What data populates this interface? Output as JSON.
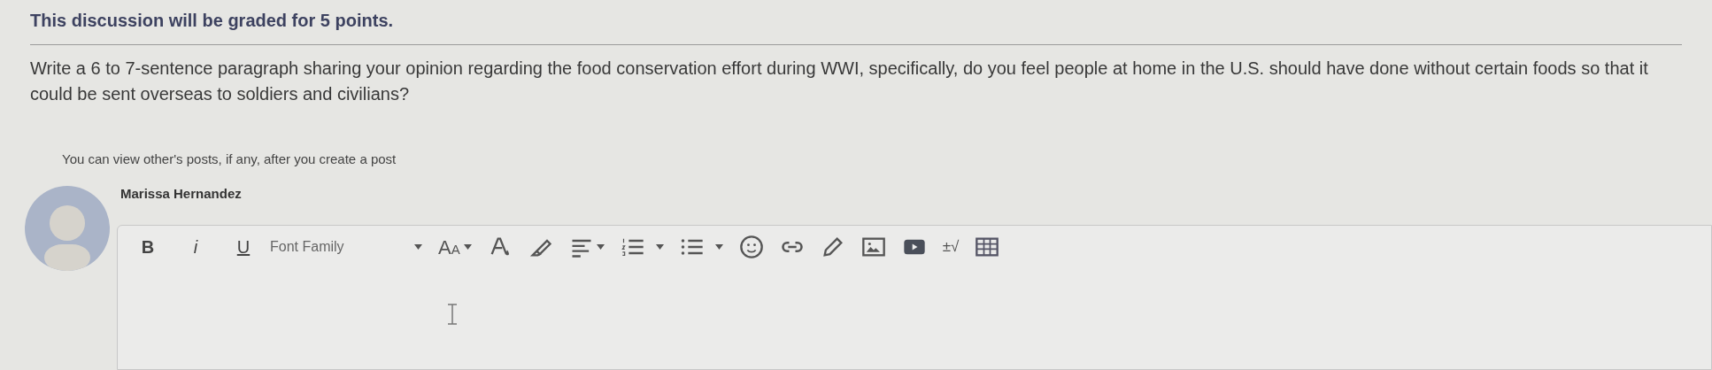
{
  "heading": "This discussion will be graded for 5 points.",
  "prompt": "Write a 6 to 7-sentence paragraph sharing your opinion regarding the food conservation effort during WWI, specifically, do you feel people at home in the U.S. should have done without certain foods so that it could be sent overseas to soldiers and civilians?",
  "notice": "You can view other's posts, if any, after you create a post",
  "author": "Marissa Hernandez",
  "toolbar": {
    "bold": "B",
    "italic": "i",
    "underline": "U",
    "font_family": "Font Family",
    "font_size": "AA",
    "math": "±√"
  }
}
